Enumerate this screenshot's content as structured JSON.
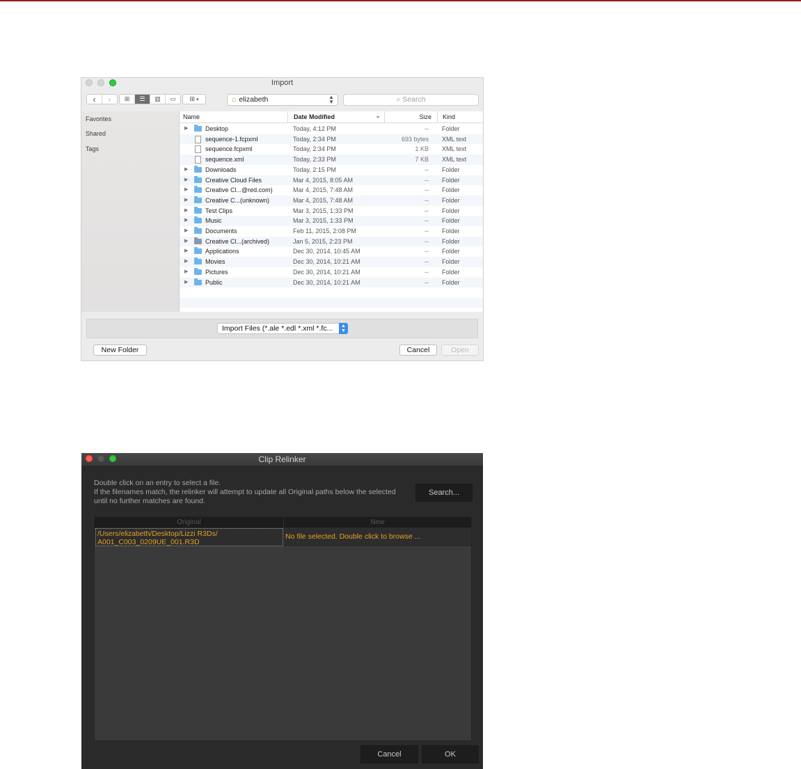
{
  "import_dialog": {
    "title": "Import",
    "toolbar": {
      "back_glyph": "‹",
      "forward_glyph": "›",
      "location": "elizabeth",
      "search_placeholder": "Search"
    },
    "sidebar": [
      "Favorites",
      "Shared",
      "Tags"
    ],
    "columns": {
      "name": "Name",
      "date": "Date Modified",
      "size": "Size",
      "kind": "Kind"
    },
    "files": [
      {
        "name": "Desktop",
        "date": "Today, 4:12 PM",
        "size": "--",
        "kind": "Folder",
        "type": "folder"
      },
      {
        "name": "sequence-1.fcpxml",
        "date": "Today, 2:34 PM",
        "size": "693 bytes",
        "kind": "XML text",
        "type": "doc"
      },
      {
        "name": "sequence.fcpxml",
        "date": "Today, 2:34 PM",
        "size": "1 KB",
        "kind": "XML text",
        "type": "doc"
      },
      {
        "name": "sequence.xml",
        "date": "Today, 2:33 PM",
        "size": "7 KB",
        "kind": "XML text",
        "type": "doc"
      },
      {
        "name": "Downloads",
        "date": "Today, 2:15 PM",
        "size": "--",
        "kind": "Folder",
        "type": "folder"
      },
      {
        "name": "Creative Cloud Files",
        "date": "Mar 4, 2015, 8:05 AM",
        "size": "--",
        "kind": "Folder",
        "type": "folder"
      },
      {
        "name": "Creative Cl...@red.com)",
        "date": "Mar 4, 2015, 7:48 AM",
        "size": "--",
        "kind": "Folder",
        "type": "folder"
      },
      {
        "name": "Creative C...(unknown)",
        "date": "Mar 4, 2015, 7:48 AM",
        "size": "--",
        "kind": "Folder",
        "type": "folder"
      },
      {
        "name": "Test Clips",
        "date": "Mar 3, 2015, 1:33 PM",
        "size": "--",
        "kind": "Folder",
        "type": "folder"
      },
      {
        "name": "Music",
        "date": "Mar 3, 2015, 1:33 PM",
        "size": "--",
        "kind": "Folder",
        "type": "folder"
      },
      {
        "name": "Documents",
        "date": "Feb 11, 2015, 2:08 PM",
        "size": "--",
        "kind": "Folder",
        "type": "folder"
      },
      {
        "name": "Creative Cl...(archived)",
        "date": "Jan 5, 2015, 2:23 PM",
        "size": "--",
        "kind": "Folder",
        "type": "gray"
      },
      {
        "name": "Applications",
        "date": "Dec 30, 2014, 10:45 AM",
        "size": "--",
        "kind": "Folder",
        "type": "folder"
      },
      {
        "name": "Movies",
        "date": "Dec 30, 2014, 10:21 AM",
        "size": "--",
        "kind": "Folder",
        "type": "folder"
      },
      {
        "name": "Pictures",
        "date": "Dec 30, 2014, 10:21 AM",
        "size": "--",
        "kind": "Folder",
        "type": "folder"
      },
      {
        "name": "Public",
        "date": "Dec 30, 2014, 10:21 AM",
        "size": "--",
        "kind": "Folder",
        "type": "folder"
      }
    ],
    "file_filter": "Import Files (*.ale *.edl *.xml *.fc...",
    "new_folder_label": "New Folder",
    "cancel_label": "Cancel",
    "open_label": "Open",
    "colors": {
      "folder": "#6eb4ec",
      "accent": "#3b8de8"
    }
  },
  "relinker": {
    "title": "Clip Relinker",
    "instructions": [
      "Double click on an entry to select a file.",
      "If the filenames match, the relinker will attempt to update all Original paths below the selected",
      "until no further matches are found."
    ],
    "search_label": "Search...",
    "columns": {
      "original": "Original",
      "new": "New"
    },
    "row": {
      "original_line1": "/Users/elizabeth/Desktop/Lizzi R3Ds/",
      "original_line2": "A001_C003_0209UE_001.R3D",
      "new": "No file selected. Double click to browse ..."
    },
    "cancel_label": "Cancel",
    "ok_label": "OK",
    "colors": {
      "path_text": "#e6a025",
      "background": "#2a2a2a"
    }
  }
}
